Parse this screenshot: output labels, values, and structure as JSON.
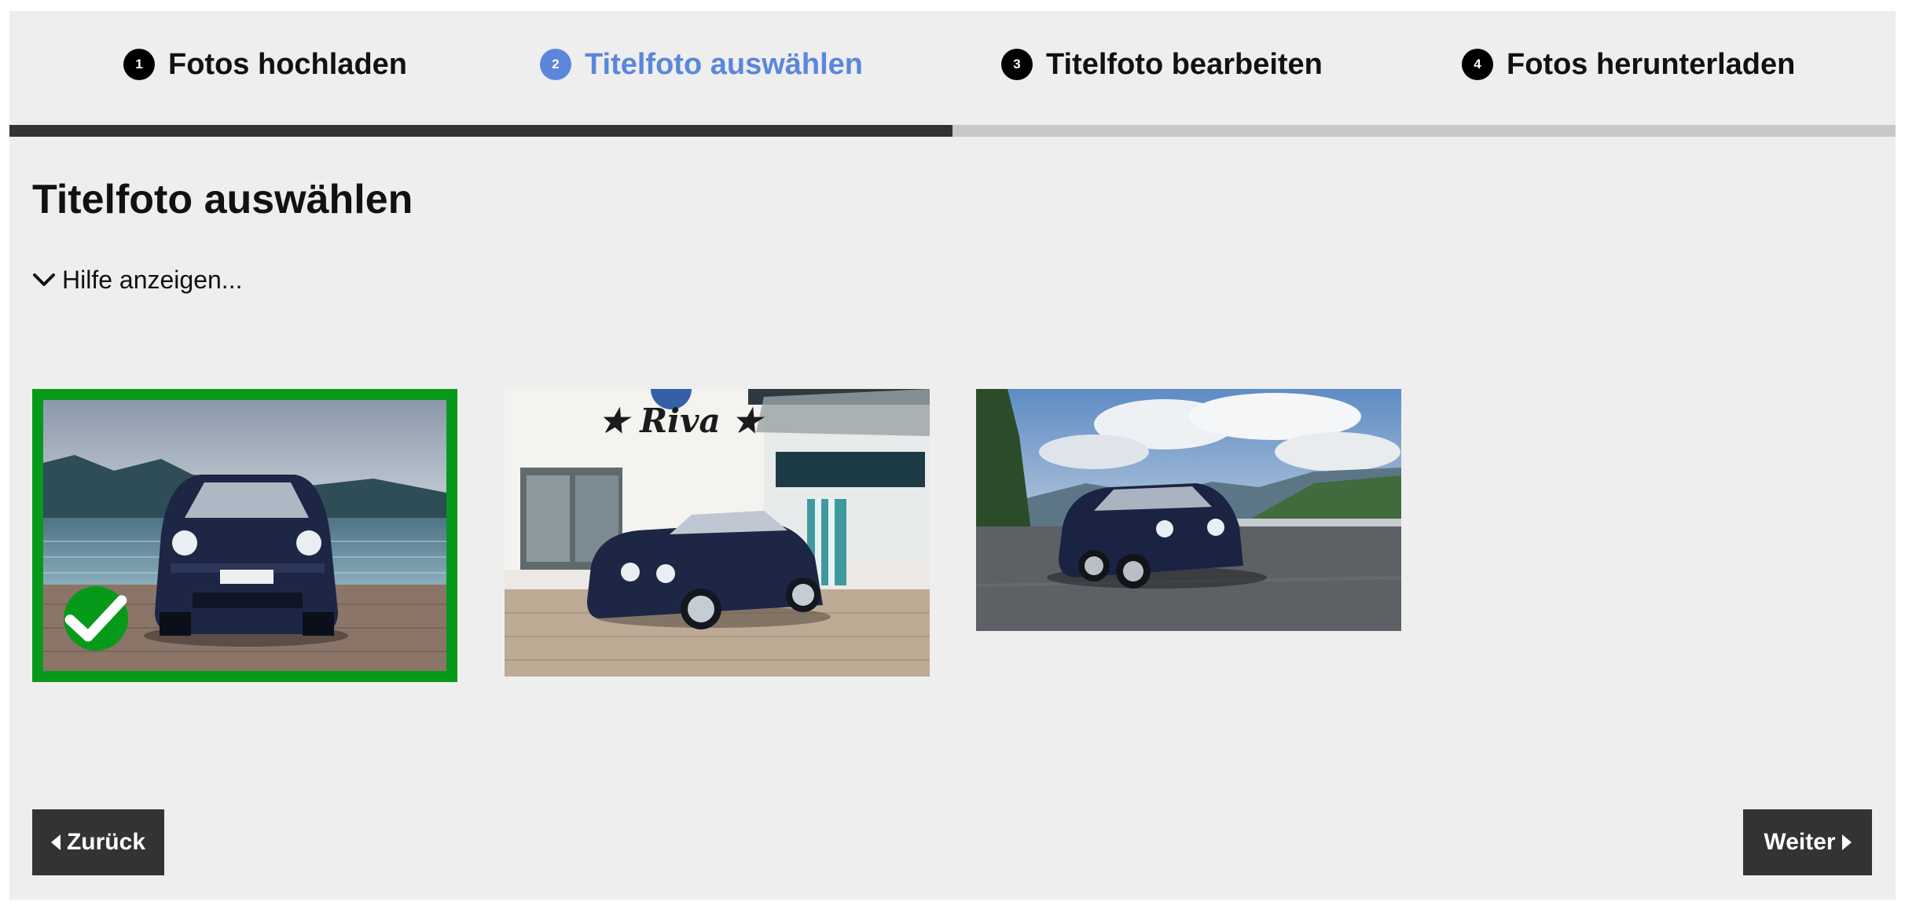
{
  "steps": [
    {
      "number": "1",
      "label": "Fotos hochladen",
      "active": false
    },
    {
      "number": "2",
      "label": "Titelfoto auswählen",
      "active": true
    },
    {
      "number": "3",
      "label": "Titelfoto bearbeiten",
      "active": false
    },
    {
      "number": "4",
      "label": "Fotos herunterladen",
      "active": false
    }
  ],
  "progress": 0.5,
  "page": {
    "title": "Titelfoto auswählen",
    "help_toggle": "Hilfe anzeigen..."
  },
  "photos": [
    {
      "name": "photo-lake",
      "selected": true
    },
    {
      "name": "photo-riva-building",
      "selected": false
    },
    {
      "name": "photo-mountain-road",
      "selected": false
    }
  ],
  "nav": {
    "back_label": "Zurück",
    "next_label": "Weiter"
  },
  "colors": {
    "accent": "#5b86dc",
    "selected": "#079a1a",
    "button": "#333333",
    "background": "#eeeeee"
  },
  "icons": {
    "help_toggle": "chevron-down-icon",
    "back": "caret-left-icon",
    "next": "caret-right-icon",
    "selected": "checkmark-icon"
  }
}
